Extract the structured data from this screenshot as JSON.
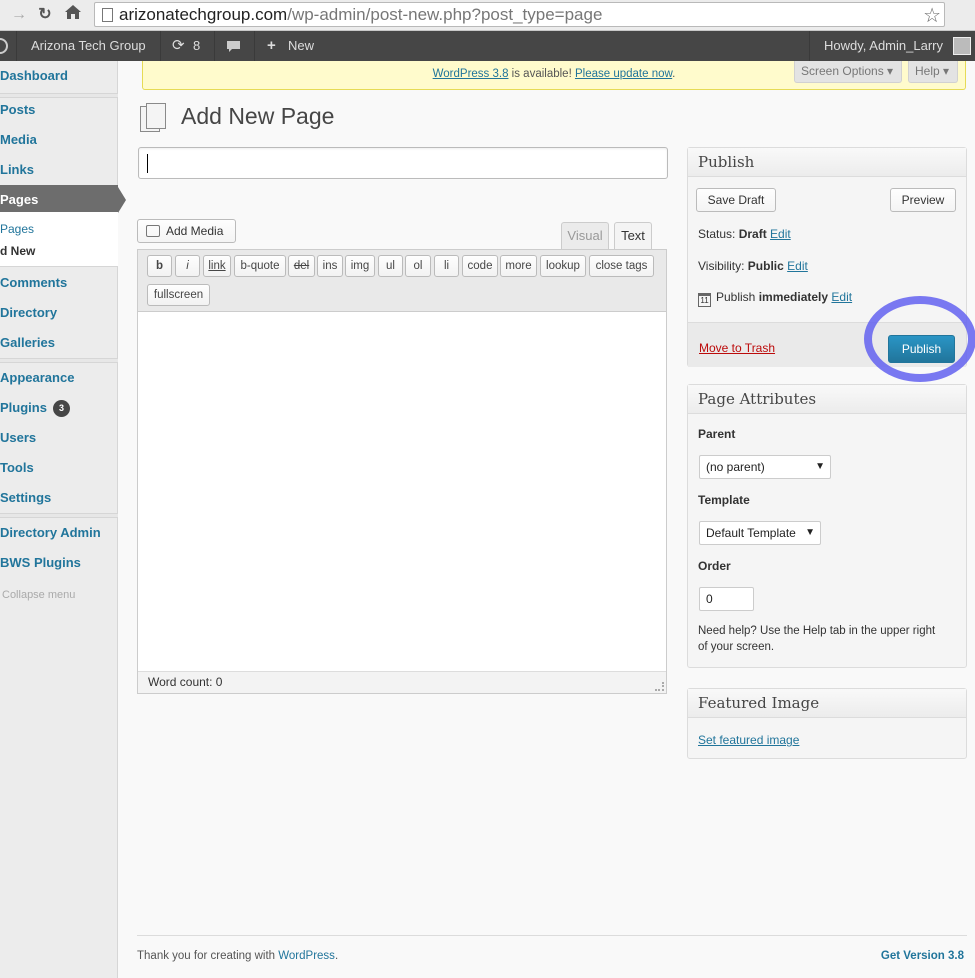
{
  "browser": {
    "url_host": "arizonatechgroup.com",
    "url_path": "/wp-admin/post-new.php?post_type=page",
    "back_icon": "arrow-right-icon",
    "reload_icon": "reload-icon",
    "home_icon": "home-icon",
    "star_icon": "star-icon"
  },
  "adminbar": {
    "site_name": "Arizona Tech Group",
    "updates_count": "8",
    "new_label": "New",
    "howdy": "Howdy, Admin_Larry"
  },
  "sidebar": {
    "items": {
      "dashboard": "Dashboard",
      "posts": "Posts",
      "media": "Media",
      "links": "Links",
      "pages": "Pages",
      "comments": "Comments",
      "directory": "Directory",
      "galleries": "Galleries",
      "appearance": "Appearance",
      "plugins": "Plugins",
      "plugins_badge": "3",
      "users": "Users",
      "tools": "Tools",
      "settings": "Settings",
      "directory_admin": "Directory Admin",
      "bws_plugins": "BWS Plugins",
      "collapse": "Collapse menu"
    },
    "submenu": {
      "all_pages": "Pages",
      "add_new": "d New"
    }
  },
  "notice": {
    "link1": "WordPress 3.8",
    "text": " is available! ",
    "link2": "Please update now",
    "end": "."
  },
  "tabs": {
    "screen_options": "Screen Options ▾",
    "help": "Help ▾"
  },
  "main": {
    "title": "Add New Page",
    "title_value": ""
  },
  "editor": {
    "add_media": "Add Media",
    "tab_visual": "Visual",
    "tab_text": "Text",
    "quicktags": [
      "b",
      "i",
      "link",
      "b-quote",
      "del",
      "ins",
      "img",
      "ul",
      "ol",
      "li",
      "code",
      "more",
      "lookup",
      "close tags",
      "fullscreen"
    ],
    "word_count": "Word count: 0"
  },
  "publish": {
    "title": "Publish",
    "save_draft": "Save Draft",
    "preview": "Preview",
    "status_label": "Status: ",
    "status_value": "Draft",
    "visibility_label": "Visibility: ",
    "visibility_value": "Public",
    "publish_label": "Publish ",
    "publish_value": "immediately",
    "edit": "Edit",
    "trash": "Move to Trash",
    "publish_button": "Publish"
  },
  "page_attributes": {
    "title": "Page Attributes",
    "parent_label": "Parent",
    "parent_value": "(no parent)",
    "template_label": "Template",
    "template_value": "Default Template",
    "order_label": "Order",
    "order_value": "0",
    "help_line1": "Need help? Use the Help tab in the upper right",
    "help_line2": "of your screen."
  },
  "featured_image": {
    "title": "Featured Image",
    "link": "Set featured image"
  },
  "footer": {
    "thanks": "Thank you for creating with ",
    "wp_link": "WordPress",
    "period": ".",
    "version": "Get Version 3.8"
  },
  "colors": {
    "link": "#21759b",
    "adminbar": "#464646",
    "notice_bg": "#fffbcc",
    "highlight_ring": "#6362f0",
    "trash": "#bc0b0b"
  }
}
